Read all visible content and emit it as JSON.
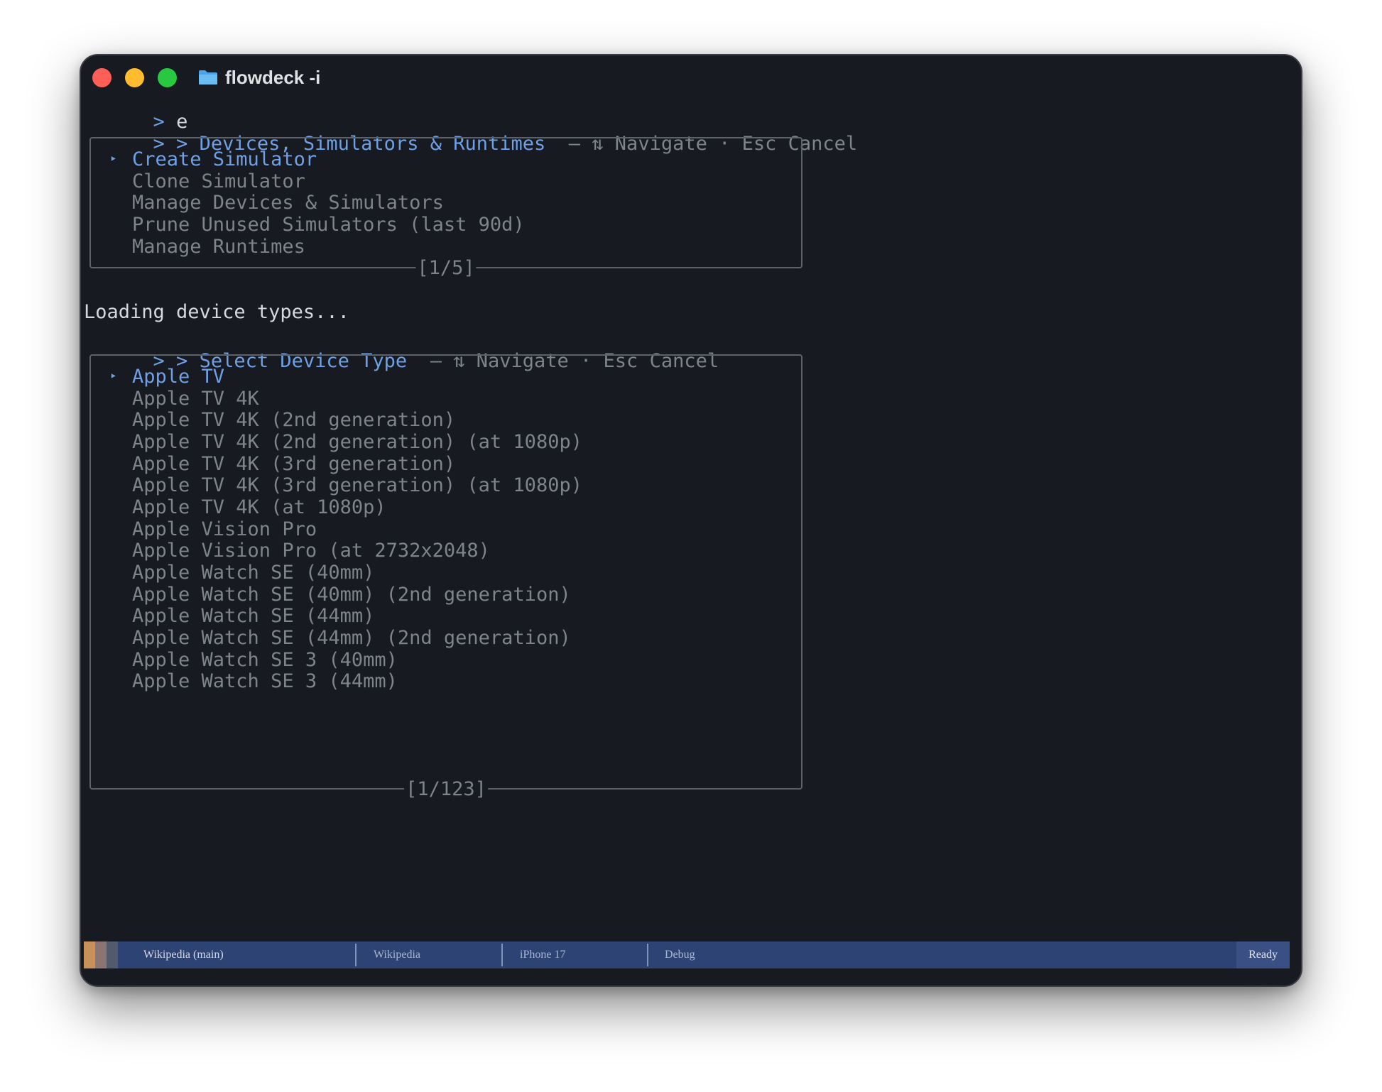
{
  "window": {
    "title": "flowdeck -i",
    "colors": {
      "background": "#171a20",
      "accent": "#6fa0e6",
      "dim": "#7e838c"
    }
  },
  "terminal": {
    "input_prompt": ">",
    "input_text": "e",
    "menu1": {
      "prompt": "> >",
      "title": "Devices, Simulators & Runtimes",
      "hint": "— ⇅ Navigate · Esc Cancel",
      "items": [
        "Create Simulator",
        "Clone Simulator",
        "Manage Devices & Simulators",
        "Prune Unused Simulators (last 90d)",
        "Manage Runtimes"
      ],
      "selected_marker": "‣",
      "counter": "[1/5]"
    },
    "loading_text": "Loading device types...",
    "menu2": {
      "prompt": "> >",
      "title": "Select Device Type",
      "hint": "— ⇅ Navigate · Esc Cancel",
      "items": [
        "Apple TV",
        "Apple TV 4K",
        "Apple TV 4K (2nd generation)",
        "Apple TV 4K (2nd generation) (at 1080p)",
        "Apple TV 4K (3rd generation)",
        "Apple TV 4K (3rd generation) (at 1080p)",
        "Apple TV 4K (at 1080p)",
        "Apple Vision Pro",
        "Apple Vision Pro (at 2732x2048)",
        "Apple Watch SE (40mm)",
        "Apple Watch SE (40mm) (2nd generation)",
        "Apple Watch SE (44mm)",
        "Apple Watch SE (44mm) (2nd generation)",
        "Apple Watch SE 3 (40mm)",
        "Apple Watch SE 3 (44mm)"
      ],
      "selected_marker": "‣",
      "counter": "[1/123]"
    }
  },
  "statusbar": {
    "project": "Wikipedia (main)",
    "scheme": "Wikipedia",
    "device": "iPhone 17",
    "configuration": "Debug",
    "status": "Ready",
    "swatch_colors": [
      "#c8915a",
      "#8a7474",
      "#525a6e"
    ]
  }
}
